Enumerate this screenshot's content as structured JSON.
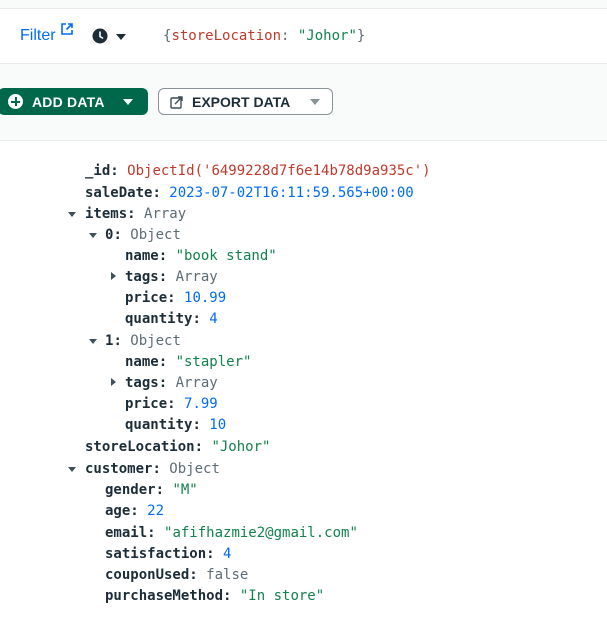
{
  "filter": {
    "link_label": "Filter",
    "link_icon": "external-link-icon",
    "history_icon": "clock-icon",
    "query_open": "{",
    "query_key": "storeLocation",
    "query_colon": ": ",
    "query_value": "\"Johor\"",
    "query_close": "}"
  },
  "toolbar": {
    "add_label": "ADD DATA",
    "export_label": "EXPORT DATA",
    "add_icon": "plus-circle-icon",
    "export_icon": "export-icon"
  },
  "colors": {
    "primary_green": "#00684a",
    "link_blue": "#016bf8",
    "string_green": "#12824d",
    "objectid_red": "#c0392b"
  },
  "document": {
    "id": {
      "key": "_id",
      "value": "ObjectId('6499228d7f6e14b78d9a935c')"
    },
    "saleDate": {
      "key": "saleDate",
      "value": "2023-07-02T16:11:59.565+00:00"
    },
    "items": {
      "key": "items",
      "type": "Array",
      "entries": [
        {
          "key": "0",
          "type": "Object",
          "name": {
            "key": "name",
            "value": "\"book stand\""
          },
          "tags": {
            "key": "tags",
            "type": "Array"
          },
          "price": {
            "key": "price",
            "value": "10.99"
          },
          "quantity": {
            "key": "quantity",
            "value": "4"
          }
        },
        {
          "key": "1",
          "type": "Object",
          "name": {
            "key": "name",
            "value": "\"stapler\""
          },
          "tags": {
            "key": "tags",
            "type": "Array"
          },
          "price": {
            "key": "price",
            "value": "7.99"
          },
          "quantity": {
            "key": "quantity",
            "value": "10"
          }
        }
      ]
    },
    "storeLocation": {
      "key": "storeLocation",
      "value": "\"Johor\""
    },
    "customer": {
      "key": "customer",
      "type": "Object",
      "gender": {
        "key": "gender",
        "value": "\"M\""
      },
      "age": {
        "key": "age",
        "value": "22"
      },
      "email": {
        "key": "email",
        "value": "\"afifhazmie2@gmail.com\""
      },
      "satisfaction": {
        "key": "satisfaction",
        "value": "4"
      },
      "couponUsed": {
        "key": "couponUsed",
        "value": "false"
      },
      "purchaseMethod": {
        "key": "purchaseMethod",
        "value": "\"In store\""
      }
    }
  }
}
